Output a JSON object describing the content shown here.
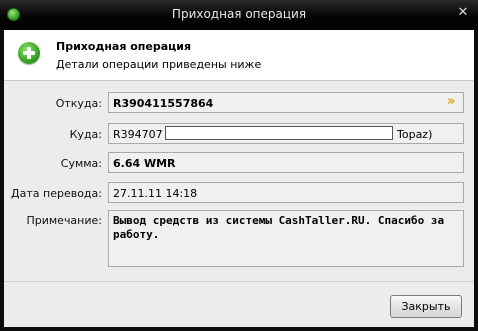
{
  "window": {
    "title": "Приходная операция",
    "close_glyph": "✕"
  },
  "header": {
    "title": "Приходная операция",
    "subtitle": "Детали операции приведены ниже"
  },
  "fields": {
    "from_label": "Откуда:",
    "from_value": "R390411557864",
    "to_label": "Куда:",
    "to_value_prefix": "R394707",
    "to_value_suffix": "Topaz)",
    "amount_label": "Сумма:",
    "amount_value": "6.64 WMR",
    "date_label": "Дата перевода:",
    "date_value": "27.11.11 14:18",
    "note_label": "Примечание:",
    "note_value": "Вывод средств из системы CashTaller.RU. Спасибо за работу."
  },
  "buttons": {
    "close_label": "Закрыть"
  },
  "icons": {
    "from_arrow": "»"
  }
}
